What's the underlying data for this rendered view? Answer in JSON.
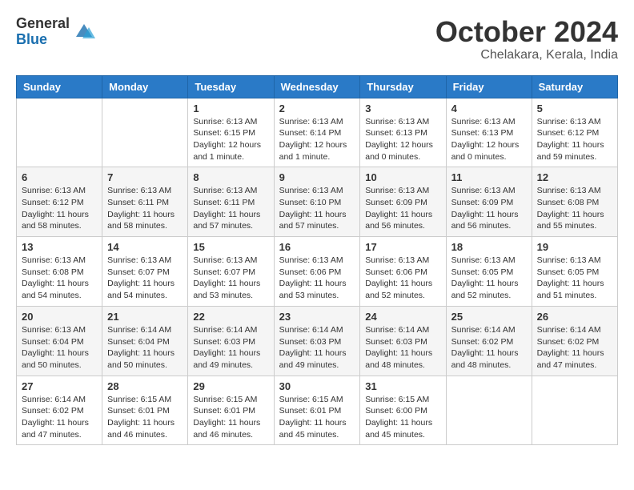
{
  "logo": {
    "general": "General",
    "blue": "Blue"
  },
  "title": "October 2024",
  "location": "Chelakara, Kerala, India",
  "headers": [
    "Sunday",
    "Monday",
    "Tuesday",
    "Wednesday",
    "Thursday",
    "Friday",
    "Saturday"
  ],
  "weeks": [
    [
      {
        "day": "",
        "info": ""
      },
      {
        "day": "",
        "info": ""
      },
      {
        "day": "1",
        "info": "Sunrise: 6:13 AM\nSunset: 6:15 PM\nDaylight: 12 hours and 1 minute."
      },
      {
        "day": "2",
        "info": "Sunrise: 6:13 AM\nSunset: 6:14 PM\nDaylight: 12 hours and 1 minute."
      },
      {
        "day": "3",
        "info": "Sunrise: 6:13 AM\nSunset: 6:13 PM\nDaylight: 12 hours and 0 minutes."
      },
      {
        "day": "4",
        "info": "Sunrise: 6:13 AM\nSunset: 6:13 PM\nDaylight: 12 hours and 0 minutes."
      },
      {
        "day": "5",
        "info": "Sunrise: 6:13 AM\nSunset: 6:12 PM\nDaylight: 11 hours and 59 minutes."
      }
    ],
    [
      {
        "day": "6",
        "info": "Sunrise: 6:13 AM\nSunset: 6:12 PM\nDaylight: 11 hours and 58 minutes."
      },
      {
        "day": "7",
        "info": "Sunrise: 6:13 AM\nSunset: 6:11 PM\nDaylight: 11 hours and 58 minutes."
      },
      {
        "day": "8",
        "info": "Sunrise: 6:13 AM\nSunset: 6:11 PM\nDaylight: 11 hours and 57 minutes."
      },
      {
        "day": "9",
        "info": "Sunrise: 6:13 AM\nSunset: 6:10 PM\nDaylight: 11 hours and 57 minutes."
      },
      {
        "day": "10",
        "info": "Sunrise: 6:13 AM\nSunset: 6:09 PM\nDaylight: 11 hours and 56 minutes."
      },
      {
        "day": "11",
        "info": "Sunrise: 6:13 AM\nSunset: 6:09 PM\nDaylight: 11 hours and 56 minutes."
      },
      {
        "day": "12",
        "info": "Sunrise: 6:13 AM\nSunset: 6:08 PM\nDaylight: 11 hours and 55 minutes."
      }
    ],
    [
      {
        "day": "13",
        "info": "Sunrise: 6:13 AM\nSunset: 6:08 PM\nDaylight: 11 hours and 54 minutes."
      },
      {
        "day": "14",
        "info": "Sunrise: 6:13 AM\nSunset: 6:07 PM\nDaylight: 11 hours and 54 minutes."
      },
      {
        "day": "15",
        "info": "Sunrise: 6:13 AM\nSunset: 6:07 PM\nDaylight: 11 hours and 53 minutes."
      },
      {
        "day": "16",
        "info": "Sunrise: 6:13 AM\nSunset: 6:06 PM\nDaylight: 11 hours and 53 minutes."
      },
      {
        "day": "17",
        "info": "Sunrise: 6:13 AM\nSunset: 6:06 PM\nDaylight: 11 hours and 52 minutes."
      },
      {
        "day": "18",
        "info": "Sunrise: 6:13 AM\nSunset: 6:05 PM\nDaylight: 11 hours and 52 minutes."
      },
      {
        "day": "19",
        "info": "Sunrise: 6:13 AM\nSunset: 6:05 PM\nDaylight: 11 hours and 51 minutes."
      }
    ],
    [
      {
        "day": "20",
        "info": "Sunrise: 6:13 AM\nSunset: 6:04 PM\nDaylight: 11 hours and 50 minutes."
      },
      {
        "day": "21",
        "info": "Sunrise: 6:14 AM\nSunset: 6:04 PM\nDaylight: 11 hours and 50 minutes."
      },
      {
        "day": "22",
        "info": "Sunrise: 6:14 AM\nSunset: 6:03 PM\nDaylight: 11 hours and 49 minutes."
      },
      {
        "day": "23",
        "info": "Sunrise: 6:14 AM\nSunset: 6:03 PM\nDaylight: 11 hours and 49 minutes."
      },
      {
        "day": "24",
        "info": "Sunrise: 6:14 AM\nSunset: 6:03 PM\nDaylight: 11 hours and 48 minutes."
      },
      {
        "day": "25",
        "info": "Sunrise: 6:14 AM\nSunset: 6:02 PM\nDaylight: 11 hours and 48 minutes."
      },
      {
        "day": "26",
        "info": "Sunrise: 6:14 AM\nSunset: 6:02 PM\nDaylight: 11 hours and 47 minutes."
      }
    ],
    [
      {
        "day": "27",
        "info": "Sunrise: 6:14 AM\nSunset: 6:02 PM\nDaylight: 11 hours and 47 minutes."
      },
      {
        "day": "28",
        "info": "Sunrise: 6:15 AM\nSunset: 6:01 PM\nDaylight: 11 hours and 46 minutes."
      },
      {
        "day": "29",
        "info": "Sunrise: 6:15 AM\nSunset: 6:01 PM\nDaylight: 11 hours and 46 minutes."
      },
      {
        "day": "30",
        "info": "Sunrise: 6:15 AM\nSunset: 6:01 PM\nDaylight: 11 hours and 45 minutes."
      },
      {
        "day": "31",
        "info": "Sunrise: 6:15 AM\nSunset: 6:00 PM\nDaylight: 11 hours and 45 minutes."
      },
      {
        "day": "",
        "info": ""
      },
      {
        "day": "",
        "info": ""
      }
    ]
  ]
}
